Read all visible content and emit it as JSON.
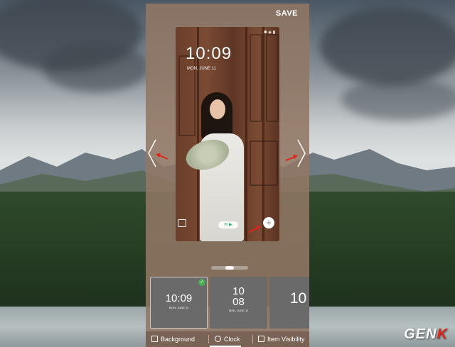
{
  "header": {
    "save_label": "SAVE"
  },
  "preview": {
    "time": "10:09",
    "date": "MON, JUNE 11",
    "status_icons": "✱ ◈ ▮",
    "camera_label": "Camera"
  },
  "thumbnails": [
    {
      "style": "horizontal",
      "time": "10:09",
      "date": "MON, JUNE 11",
      "selected": true
    },
    {
      "style": "vertical",
      "hours": "10",
      "minutes": "08",
      "date": "MON, JUNE 11",
      "selected": false
    },
    {
      "style": "large",
      "time": "10",
      "selected": false
    }
  ],
  "tabs": [
    {
      "label": "Background",
      "icon": "image-icon"
    },
    {
      "label": "Clock",
      "icon": "clock-icon"
    },
    {
      "label": "Item Visibility",
      "icon": "visibility-icon"
    }
  ],
  "watermark": {
    "text": "GEN",
    "accent": "K"
  },
  "colors": {
    "panel": "#91766a",
    "accent_red": "#e2231a",
    "check_green": "#4caf50"
  }
}
